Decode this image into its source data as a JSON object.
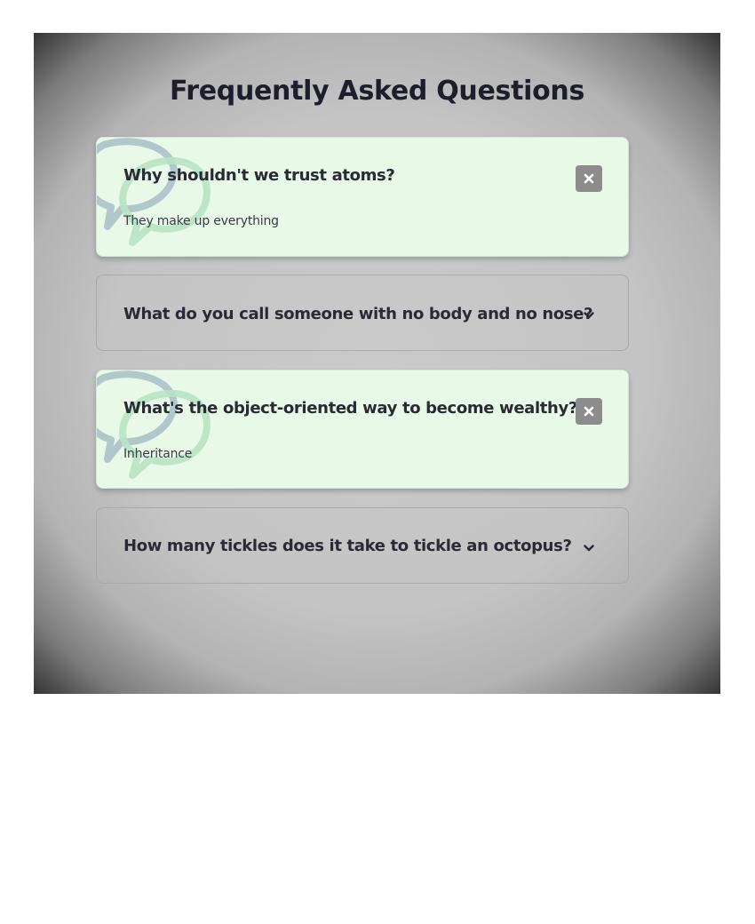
{
  "page": {
    "title": "Frequently Asked Questions"
  },
  "faq": {
    "items": [
      {
        "question": "Why shouldn't we trust atoms?",
        "answer": "They make up everything",
        "state": "open",
        "toggle_icon": "close-icon"
      },
      {
        "question": "What do you call someone with no body and no nose?",
        "state": "closed",
        "toggle_icon": "chevron-down-icon"
      },
      {
        "question": "What's the object-oriented way to become wealthy?",
        "answer": "Inheritance",
        "state": "open",
        "toggle_icon": "close-icon"
      },
      {
        "question": "How many tickles does it take to tickle an octopus?",
        "state": "closed",
        "toggle_icon": "chevron-down-icon"
      }
    ]
  },
  "colors": {
    "open_card_bg": "#e8f9e8",
    "title_text": "#1d1d2b",
    "close_button_bg": "#8c8c8c"
  }
}
